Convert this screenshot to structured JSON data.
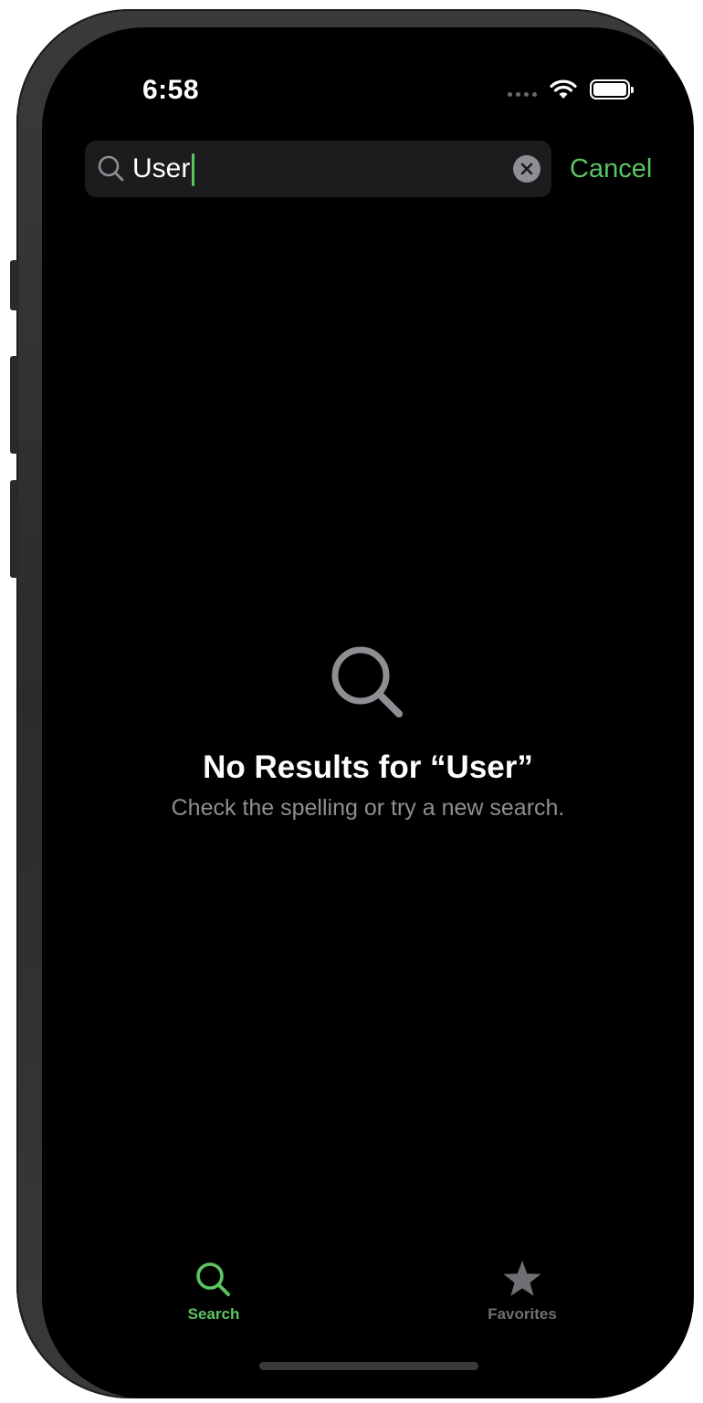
{
  "status_bar": {
    "time": "6:58"
  },
  "search": {
    "query": "User",
    "cancel_label": "Cancel"
  },
  "empty_state": {
    "title": "No Results for “User”",
    "subtitle": "Check the spelling or try a new search."
  },
  "tab_bar": {
    "tabs": [
      {
        "label": "Search",
        "icon": "magnifying-glass-icon",
        "selected": true
      },
      {
        "label": "Favorites",
        "icon": "star-icon",
        "selected": false
      }
    ]
  },
  "colors": {
    "accent": "#5ac561",
    "background": "#000000",
    "search_field": "#1c1c1e",
    "secondary_text": "#8e8e93",
    "inactive_tab": "#6e6e73"
  }
}
